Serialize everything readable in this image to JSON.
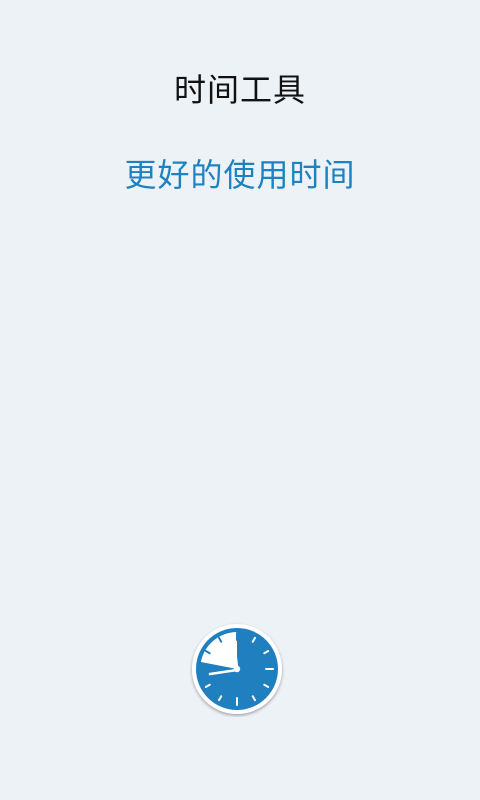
{
  "app": {
    "title": "时间工具",
    "slogan": "更好的使用时间"
  },
  "logo": {
    "icon": "clock-icon",
    "face_color": "#1f7fbf",
    "rim_color": "#ffffff",
    "accent_color": "#ffffff"
  }
}
